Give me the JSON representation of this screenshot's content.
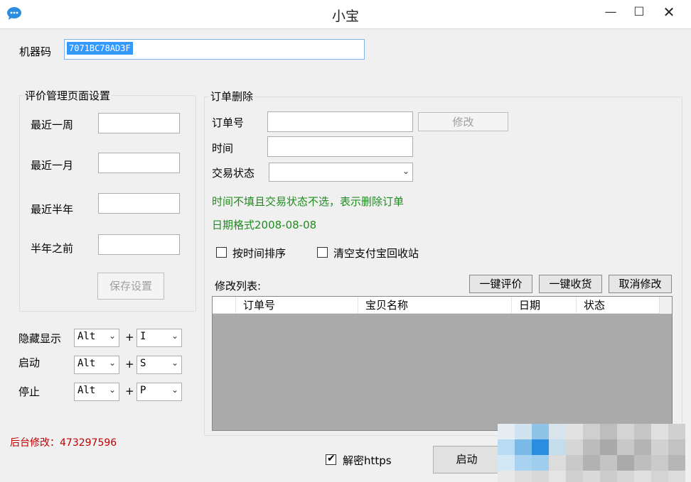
{
  "window": {
    "title": "小宝",
    "minimize": "—",
    "maximize": "☐",
    "close": "✕"
  },
  "machine": {
    "label": "机器码",
    "value": "7071BC78AD3F"
  },
  "review": {
    "title": "评价管理页面设置",
    "fields": [
      {
        "label": "最近一周",
        "value": ""
      },
      {
        "label": "最近一月",
        "value": ""
      },
      {
        "label": "最近半年",
        "value": ""
      },
      {
        "label": "半年之前",
        "value": ""
      }
    ],
    "save_label": "保存设置"
  },
  "hotkeys": [
    {
      "label": "隐藏显示",
      "modifier": "Alt",
      "plus": "+",
      "key": "I"
    },
    {
      "label": "启动",
      "modifier": "Alt",
      "plus": "+",
      "key": "S"
    },
    {
      "label": "停止",
      "modifier": "Alt",
      "plus": "+",
      "key": "P"
    }
  ],
  "backend": "后台修改：473297596",
  "order_delete": {
    "title": "订单删除",
    "order_no_label": "订单号",
    "order_no_value": "",
    "modify_label": "修改",
    "time_label": "时间",
    "time_value": "",
    "status_label": "交易状态",
    "status_value": "",
    "hint1": "时间不填且交易状态不选，表示删除订单",
    "hint2": "日期格式2008-08-08",
    "sort_label": "按时间排序",
    "clear_label": "清空支付宝回收站"
  },
  "list": {
    "label": "修改列表:",
    "buttons": {
      "review_all": "一键评价",
      "receive_all": "一键收货",
      "cancel": "取消修改"
    },
    "columns": [
      "订单号",
      "宝贝名称",
      "日期",
      "状态"
    ]
  },
  "footer": {
    "decrypt_label": "解密https",
    "decrypt_checked": true,
    "start_label": "启动"
  },
  "colors": {
    "hint_green": "#1f8c1f",
    "backend_red": "#c00000",
    "selection": "#3399ff"
  }
}
